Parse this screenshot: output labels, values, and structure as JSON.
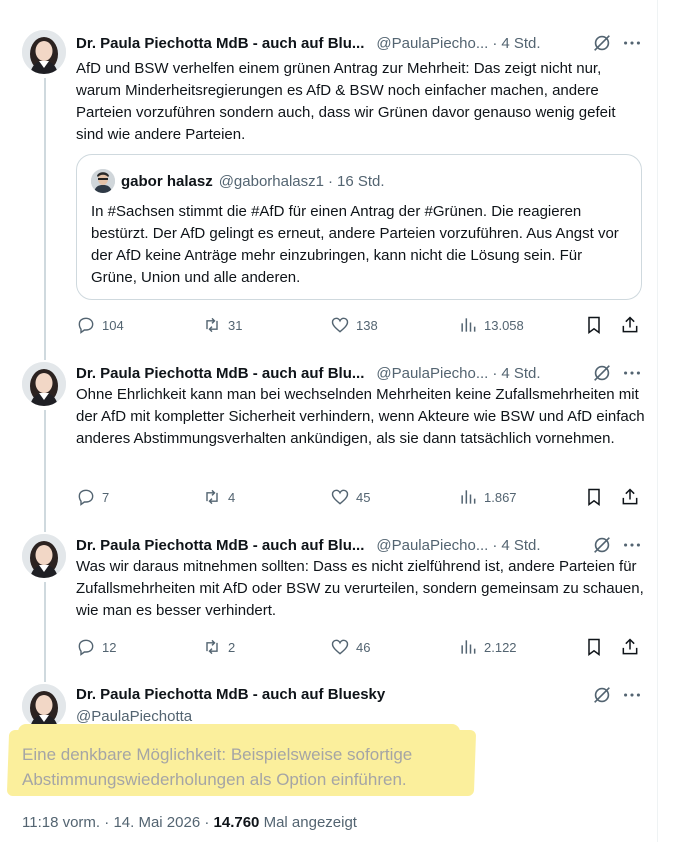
{
  "tweets": [
    {
      "name": "Dr. Paula Piechotta MdB - auch auf Blu...",
      "handle": "@PaulaPiecho...",
      "time": "4 Std.",
      "text": "AfD und BSW verhelfen einem grünen Antrag zur Mehrheit: Das zeigt nicht nur, warum Minderheitsregierungen es AfD & BSW noch einfacher machen, andere Parteien vorzuführen sondern auch, dass wir Grünen davor genauso wenig gefeit sind wie andere Parteien.",
      "quote": {
        "name": "gabor halasz",
        "handle": "@gaborhalasz1",
        "time": "16 Std.",
        "text": "In #Sachsen stimmt die #AfD für einen Antrag der #Grünen. Die reagieren bestürzt. Der AfD gelingt es erneut, andere Parteien vorzuführen. Aus Angst vor der AfD keine Anträge mehr einzubringen, kann nicht die Lösung sein. Für Grüne, Union und alle anderen."
      },
      "stats": {
        "replies": "104",
        "reposts": "31",
        "likes": "138",
        "views": "13.058"
      }
    },
    {
      "name": "Dr. Paula Piechotta MdB - auch auf Blu...",
      "handle": "@PaulaPiecho...",
      "time": "4 Std.",
      "text": "Ohne Ehrlichkeit kann man bei wechselnden Mehrheiten keine Zufallsmehrheiten mit der AfD mit kompletter Sicherheit verhindern, wenn Akteure wie BSW und AfD einfach anderes Abstimmungsverhalten ankündigen, als sie dann tatsächlich vornehmen.",
      "stats": {
        "replies": "7",
        "reposts": "4",
        "likes": "45",
        "views": "1.867"
      }
    },
    {
      "name": "Dr. Paula Piechotta MdB - auch auf Blu...",
      "handle": "@PaulaPiecho...",
      "time": "4 Std.",
      "text": "Was wir daraus mitnehmen sollten: Dass es nicht zielführend ist, andere Parteien für Zufallsmehrheiten mit AfD oder BSW zu verurteilen, sondern gemeinsam zu schauen, wie man es besser verhindert.",
      "stats": {
        "replies": "12",
        "reposts": "2",
        "likes": "46",
        "views": "2.122"
      }
    }
  ],
  "main": {
    "name": "Dr. Paula Piechotta MdB - auch auf Bluesky",
    "handle": "@PaulaPiechotta",
    "text": "Eine denkbare Möglichkeit: Beispielsweise sofortige Abstimmungswiederholungen als Option einführen.",
    "time": "11:18 vorm.",
    "date": "14. Mai 2026",
    "views": "14.760",
    "views_label": "Mal angezeigt"
  },
  "colors": {
    "highlight": "#fbef9c",
    "muted": "#536471",
    "text": "#0f1419",
    "border": "#cfd9de"
  },
  "icons": [
    "grok-icon",
    "more-icon",
    "reply-icon",
    "repost-icon",
    "like-icon",
    "views-icon",
    "bookmark-icon",
    "share-icon"
  ]
}
